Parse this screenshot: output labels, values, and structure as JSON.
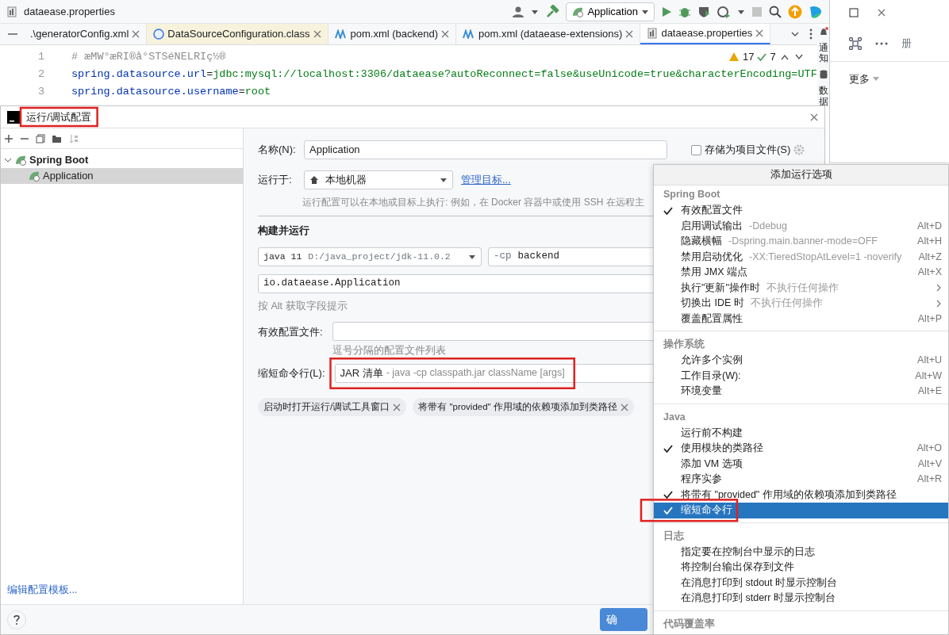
{
  "toolbar": {
    "breadcrumb": "dataease.properties",
    "run_config": "Application"
  },
  "tabs": [
    {
      "label": ".\\generatorConfig.xml",
      "kind": "xml",
      "selected": false
    },
    {
      "label": "DataSourceConfiguration.class",
      "kind": "class",
      "selected": false
    },
    {
      "label": "pom.xml (backend)",
      "kind": "maven",
      "selected": false
    },
    {
      "label": "pom.xml (dataease-extensions)",
      "kind": "maven",
      "selected": false
    },
    {
      "label": "dataease.properties",
      "kind": "properties",
      "selected": true
    }
  ],
  "editor": {
    "warnings": "17",
    "checks": "7",
    "lines": [
      {
        "number": "1",
        "kind": "comment",
        "text": "# æMW°æRI®å°STSéNELRIç½®"
      },
      {
        "number": "2",
        "kind": "property",
        "key": "spring.datasource.url",
        "separator": "=",
        "value": "jdbc:mysql://localhost:3306/dataease?autoReconnect=false&useUnicode=true&characterEncoding=UTF"
      },
      {
        "number": "3",
        "kind": "property",
        "key": "spring.datasource.username",
        "separator": "=",
        "value": "root"
      }
    ]
  },
  "side_panel": [
    "通知",
    "数据"
  ],
  "browser": {
    "side_text": "册",
    "more": "更多"
  },
  "dialog": {
    "title": "运行/调试配置",
    "tree": [
      {
        "label": "Spring Boot",
        "expanded": true,
        "children": [
          {
            "label": "Application",
            "selected": true
          }
        ]
      }
    ],
    "templates_link": "编辑配置模板...",
    "name_label": "名称(N):",
    "name_value": "Application",
    "store_label": "存储为项目文件(S)",
    "store_checked": false,
    "run_on_label": "运行于:",
    "run_on_value": "本地机器",
    "manage_link": "管理目标...",
    "run_on_hint": "运行配置可以在本地或目标上执行: 例如，在 Docker 容器中或使用 SSH 在远程主",
    "section": "构建并运行",
    "jdk_name": "java 11",
    "jdk_path": "D:/java_project/jdk-11.0.2",
    "cp_flag": "-cp",
    "cp_value": "backend",
    "main_class": "io.dataease.Application",
    "alt_hint": "按 Alt 获取字段提示",
    "profiles_label": "有效配置文件:",
    "profiles_hint": "逗号分隔的配置文件列表",
    "shorten_label": "缩短命令行(L):",
    "shorten_value": "JAR 清单",
    "shorten_detail": "- java -cp classpath.jar className [args]",
    "chips": [
      "启动时打开运行/调试工具窗口",
      "将带有 \"provided\" 作用域的依赖项添加到类路径"
    ],
    "ok_button": "确"
  },
  "menu": {
    "title": "添加运行选项",
    "groups": [
      {
        "title": "Spring Boot",
        "items": [
          {
            "label": "有效配置文件",
            "checked": true,
            "selected": false
          },
          {
            "label": "启用调试输出",
            "detail": "-Ddebug",
            "shortcut": "Alt+D",
            "checked": false,
            "selected": false
          },
          {
            "label": "隐藏横幅",
            "detail": "-Dspring.main.banner-mode=OFF",
            "shortcut": "Alt+H",
            "checked": false,
            "selected": false
          },
          {
            "label": "禁用启动优化",
            "detail": "-XX:TieredStopAtLevel=1 -noverify",
            "shortcut": "Alt+Z",
            "checked": false,
            "selected": false
          },
          {
            "label": "禁用 JMX 端点",
            "shortcut": "Alt+X",
            "checked": false,
            "selected": false
          },
          {
            "label": "执行\"更新\"操作时",
            "detail": "不执行任何操作",
            "submenu": true,
            "checked": false,
            "selected": false
          },
          {
            "label": "切换出 IDE 时",
            "detail": "不执行任何操作",
            "submenu": true,
            "checked": false,
            "selected": false
          },
          {
            "label": "覆盖配置属性",
            "shortcut": "Alt+P",
            "checked": false,
            "selected": false
          }
        ]
      },
      {
        "title": "操作系统",
        "items": [
          {
            "label": "允许多个实例",
            "shortcut": "Alt+U",
            "checked": false,
            "selected": false
          },
          {
            "label": "工作目录(W):",
            "shortcut": "Alt+W",
            "checked": false,
            "selected": false
          },
          {
            "label": "环境变量",
            "shortcut": "Alt+E",
            "checked": false,
            "selected": false
          }
        ]
      },
      {
        "title": "Java",
        "items": [
          {
            "label": "运行前不构建",
            "checked": false,
            "selected": false
          },
          {
            "label": "使用模块的类路径",
            "shortcut": "Alt+O",
            "checked": true,
            "selected": false
          },
          {
            "label": "添加 VM 选项",
            "shortcut": "Alt+V",
            "checked": false,
            "selected": false
          },
          {
            "label": "程序实参",
            "shortcut": "Alt+R",
            "checked": false,
            "selected": false
          },
          {
            "label": "将带有 \"provided\" 作用域的依赖项添加到类路径",
            "checked": true,
            "selected": false
          },
          {
            "label": "缩短命令行",
            "checked": true,
            "selected": true
          }
        ]
      },
      {
        "title": "日志",
        "items": [
          {
            "label": "指定要在控制台中显示的日志",
            "checked": false,
            "selected": false
          },
          {
            "label": "将控制台输出保存到文件",
            "checked": false,
            "selected": false
          },
          {
            "label": "在消息打印到 stdout 时显示控制台",
            "checked": false,
            "selected": false
          },
          {
            "label": "在消息打印到 stderr 时显示控制台",
            "checked": false,
            "selected": false
          }
        ]
      },
      {
        "title": "代码覆盖率"
      }
    ]
  }
}
